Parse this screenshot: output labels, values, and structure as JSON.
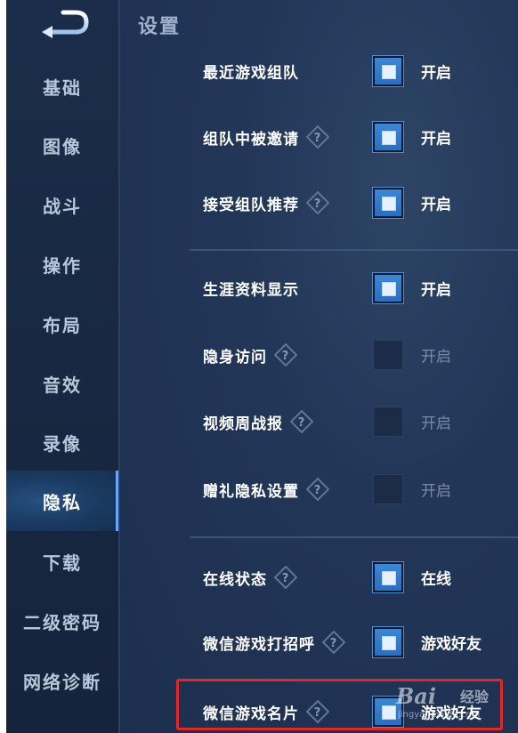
{
  "sidebar": {
    "items": [
      {
        "label": "基础",
        "active": false
      },
      {
        "label": "图像",
        "active": false
      },
      {
        "label": "战斗",
        "active": false
      },
      {
        "label": "操作",
        "active": false
      },
      {
        "label": "布局",
        "active": false
      },
      {
        "label": "音效",
        "active": false
      },
      {
        "label": "录像",
        "active": false
      },
      {
        "label": "隐私",
        "active": true
      },
      {
        "label": "下载",
        "active": false
      },
      {
        "label": "二级密码",
        "active": false
      },
      {
        "label": "网络诊断",
        "active": false
      }
    ]
  },
  "header": {
    "title": "设置"
  },
  "settings": [
    {
      "label": "最近游戏组队",
      "help": false,
      "checked": true,
      "value": "开启"
    },
    {
      "label": "组队中被邀请",
      "help": true,
      "checked": true,
      "value": "开启"
    },
    {
      "label": "接受组队推荐",
      "help": true,
      "checked": true,
      "value": "开启"
    },
    {
      "label": "生涯资料显示",
      "help": false,
      "checked": true,
      "value": "开启"
    },
    {
      "label": "隐身访问",
      "help": true,
      "checked": false,
      "value": "开启"
    },
    {
      "label": "视频周战报",
      "help": true,
      "checked": false,
      "value": "开启"
    },
    {
      "label": "赠礼隐私设置",
      "help": true,
      "checked": false,
      "value": "开启"
    },
    {
      "label": "在线状态",
      "help": true,
      "checked": true,
      "value": "在线"
    },
    {
      "label": "微信游戏打招呼",
      "help": true,
      "checked": true,
      "value": "游戏好友"
    },
    {
      "label": "微信游戏名片",
      "help": true,
      "checked": true,
      "value": "游戏好友"
    }
  ],
  "watermark": {
    "logo": "Bai",
    "text": "经验",
    "url": "jingyan.baidu.com"
  },
  "colors": {
    "accent": "#3a87d8",
    "highlight": "#e0282a",
    "background": "#1d2f4e"
  }
}
